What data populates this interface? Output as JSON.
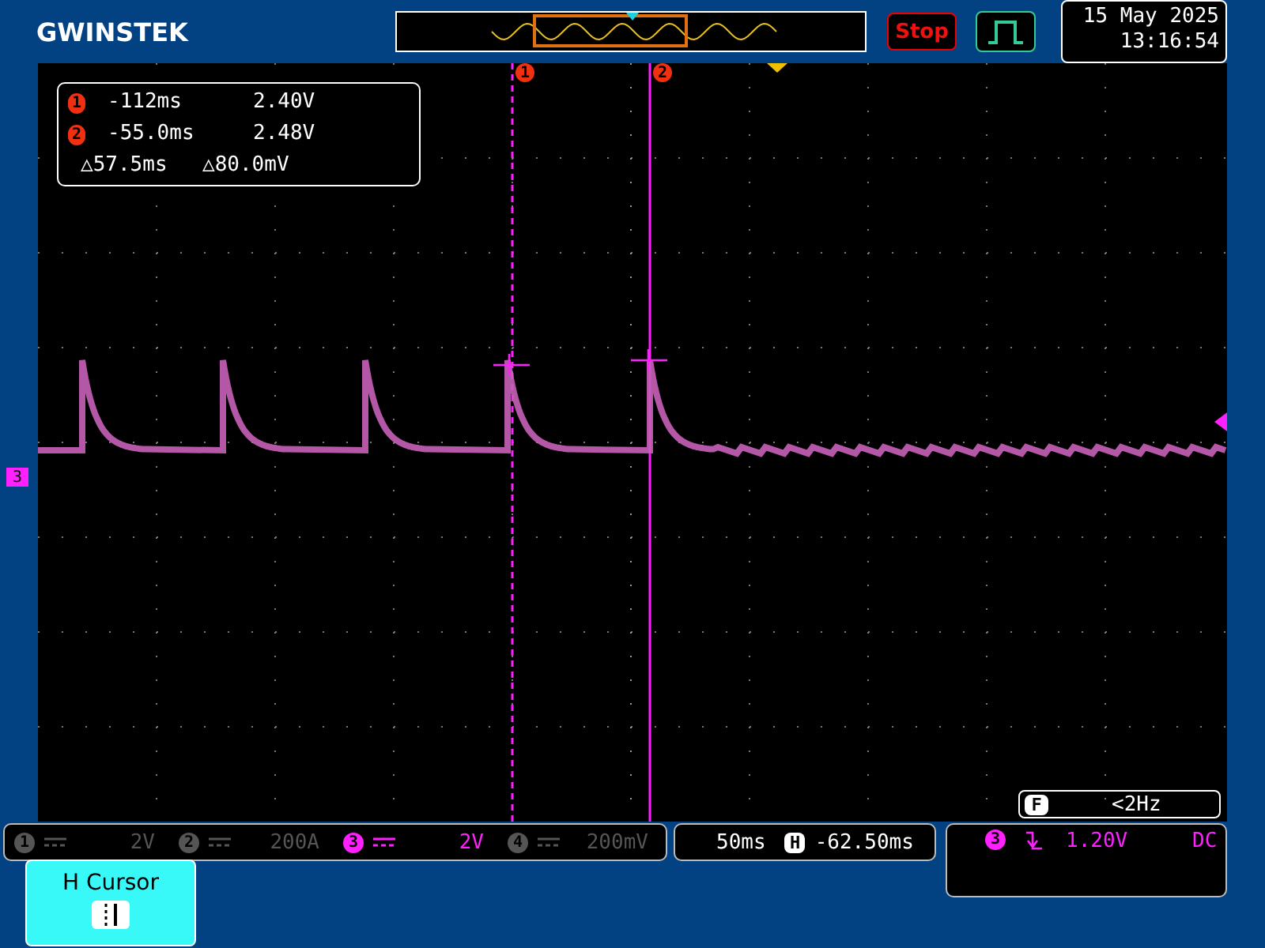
{
  "header": {
    "logo": "GWINSTEK",
    "run_state": "Stop",
    "date": "15 May 2025",
    "time": "13:16:54"
  },
  "cursor_readout": {
    "rows": [
      {
        "marker": "1",
        "time": "-112ms",
        "voltage": "2.40V"
      },
      {
        "marker": "2",
        "time": "-55.0ms",
        "voltage": "2.48V"
      }
    ],
    "delta_time": "△57.5ms",
    "delta_voltage": "△80.0mV"
  },
  "cursor_markers": [
    "1",
    "2"
  ],
  "channel_marker": "3",
  "frequency": {
    "label": "F",
    "value": "<2Hz"
  },
  "channels": [
    {
      "number": "1",
      "scale": "2V",
      "on": false
    },
    {
      "number": "2",
      "scale": "200A",
      "on": false
    },
    {
      "number": "3",
      "scale": "2V",
      "on": true
    },
    {
      "number": "4",
      "scale": "200mV",
      "on": false
    }
  ],
  "timebase": {
    "scale": "50ms",
    "position_label": "H",
    "position": "-62.50ms"
  },
  "trigger": {
    "source": "3",
    "level": "1.20V",
    "coupling": "DC"
  },
  "softkeys": [
    {
      "label": "H Cursor"
    }
  ]
}
